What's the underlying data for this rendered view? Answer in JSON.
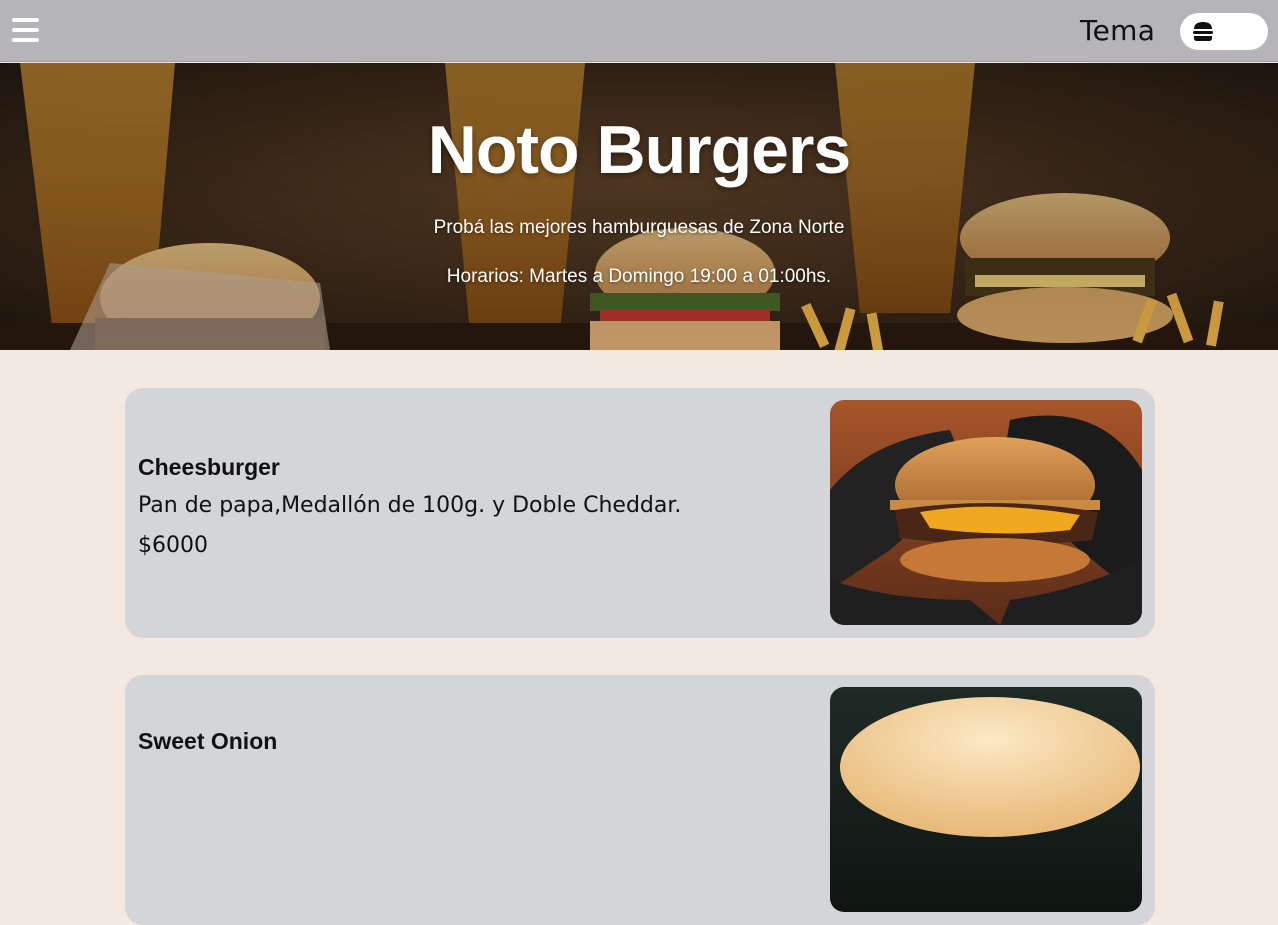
{
  "header": {
    "menu_icon": "hamburger-menu-icon",
    "theme_label": "Tema",
    "theme_toggle_icon": "burger-icon"
  },
  "hero": {
    "title": "Noto Burgers",
    "subtitle": "Probá las mejores hamburguesas de Zona Norte",
    "hours": "Horarios: Martes a Domingo 19:00 a 01:00hs."
  },
  "menu": {
    "items": [
      {
        "name": "Cheesburger",
        "description": "Pan de papa,Medallón de 100g. y Doble Cheddar.",
        "price": "$6000"
      },
      {
        "name": "Sweet Onion",
        "description": "",
        "price": ""
      }
    ]
  },
  "colors": {
    "topbar": "#b5b4b8",
    "page_background": "#f3e9e0",
    "card_background": "#d4d5d9",
    "text": "#111111",
    "hero_text": "#ffffff"
  }
}
